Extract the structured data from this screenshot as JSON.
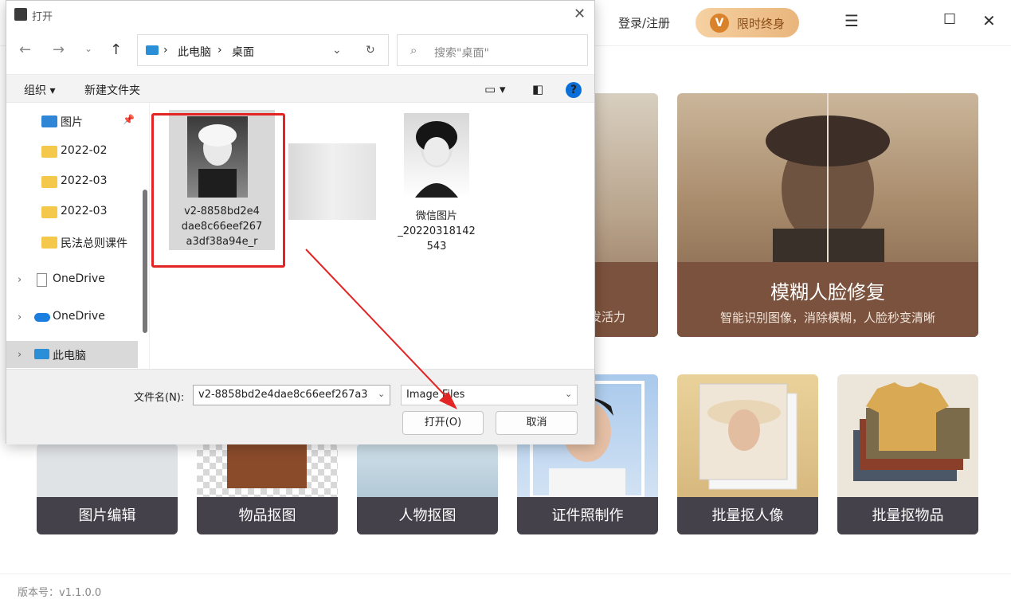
{
  "app": {
    "login": "登录/注册",
    "vip_label": "限时终身",
    "vip_badge": "V",
    "version": "版本号：v1.1.0.0",
    "feature_big": {
      "title": "模糊人脸修复",
      "subtitle": "智能识别图像，消除模糊，人脸秒变清晰"
    },
    "feature_mid_subtitle": "发活力",
    "tools": [
      "图片编辑",
      "物品抠图",
      "人物抠图",
      "证件照制作",
      "批量抠人像",
      "批量抠物品"
    ]
  },
  "dialog": {
    "title": "打开",
    "breadcrumb": [
      "此电脑",
      "桌面"
    ],
    "search_placeholder": "搜索\"桌面\"",
    "organize": "组织 ▾",
    "new_folder": "新建文件夹",
    "sidebar": [
      {
        "label": "图片",
        "type": "pictures"
      },
      {
        "label": "2022-02",
        "type": "folder"
      },
      {
        "label": "2022-03",
        "type": "folder"
      },
      {
        "label": "2022-03",
        "type": "folder"
      },
      {
        "label": "民法总则课件",
        "type": "folder"
      },
      {
        "label": "OneDrive",
        "type": "onedrive"
      },
      {
        "label": "OneDrive",
        "type": "onedrive-cloud"
      },
      {
        "label": "此电脑",
        "type": "this-pc"
      }
    ],
    "files": [
      {
        "name": "v2-8858bd2e4\ndae8c66eef267\na3df38a94e_r"
      },
      {
        "name": "微信图片\n_20220318142\n543"
      }
    ],
    "filename_label": "文件名(N):",
    "filename_value": "v2-8858bd2e4dae8c66eef267a3",
    "filetype_value": "Image Files",
    "open_button": "打开(O)",
    "cancel_button": "取消"
  },
  "colors": {
    "accent": "#0a6fd8",
    "highlight": "#e22424",
    "vip": "#e9b57c",
    "tool_caption": "#45414b"
  }
}
